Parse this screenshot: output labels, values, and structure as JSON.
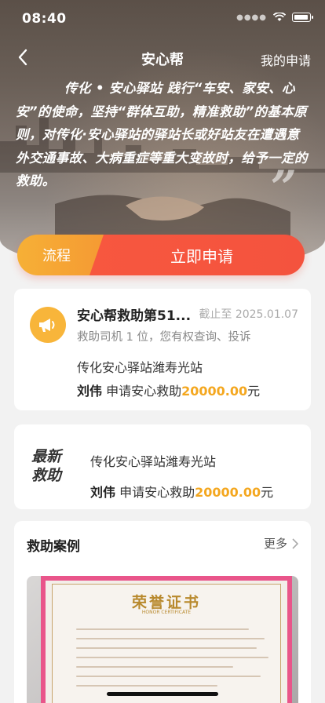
{
  "status_bar": {
    "time": "08:40"
  },
  "nav": {
    "title": "安心帮",
    "right_link": "我的申请"
  },
  "hero": {
    "intro": "传化 • 安心驿站 践行“车安、家安、心安”的使命，坚持“群体互助，精准救助”的基本原则，对传化·安心驿站的驿站长或好站友在遭遇意外交通事故、大病重症等重大变故时，给予一定的救助。",
    "quote_mark": "”"
  },
  "actions": {
    "flow_label": "流程",
    "apply_label": "立即申请"
  },
  "notice_card": {
    "title": "安心帮救助第51...",
    "deadline": "截止至 2025.01.07",
    "subtitle": "救助司机 1 位，您有权查询、投诉",
    "station": "传化安心驿站潍寿光站",
    "name": "刘伟",
    "apply_text": "申请安心救助",
    "amount": "20000.00",
    "unit": "元"
  },
  "latest_card": {
    "label": "最新救助",
    "station": "传化安心驿站潍寿光站",
    "name": "刘伟",
    "apply_text": "申请安心救助",
    "amount": "20000.00",
    "unit": "元"
  },
  "cases": {
    "title": "救助案例",
    "more": "更多",
    "certificate_title": "荣誉证书",
    "certificate_subtitle": "HONOR CERTIFICATE"
  },
  "colors": {
    "accent_orange": "#f59a33",
    "accent_red": "#f4533e",
    "amount": "#f4a71f"
  }
}
